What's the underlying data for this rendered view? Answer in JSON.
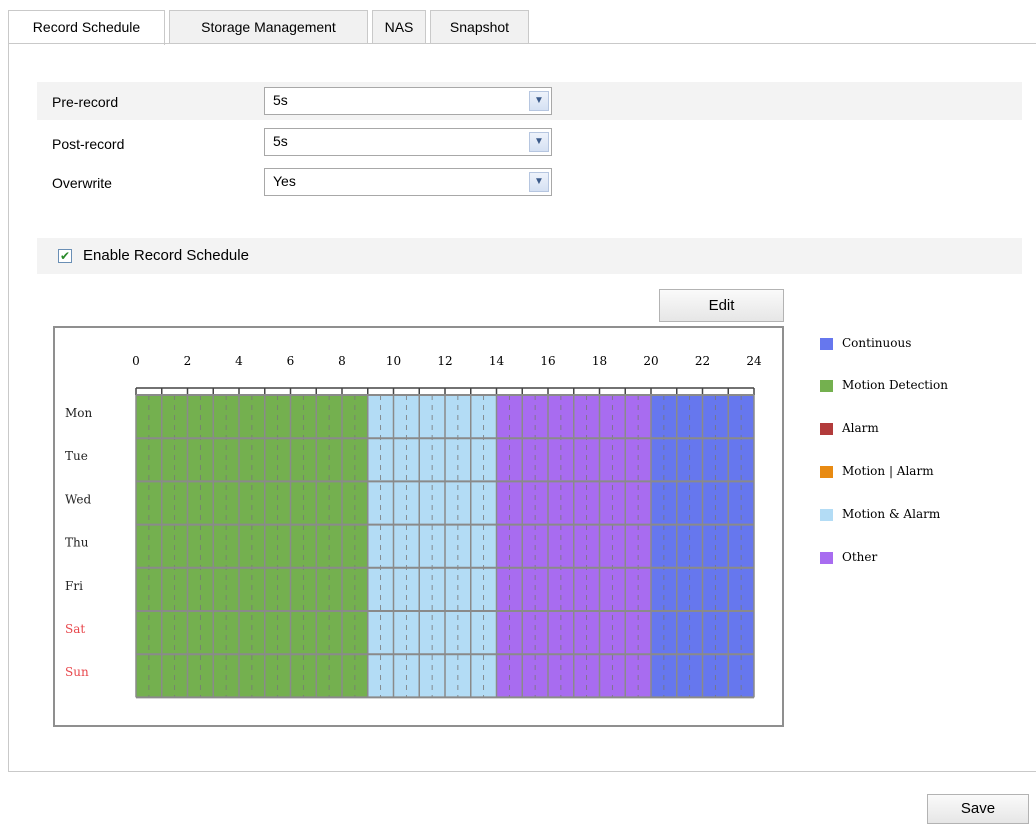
{
  "tabs": [
    {
      "label": "Record Schedule",
      "active": true
    },
    {
      "label": "Storage Management",
      "active": false
    },
    {
      "label": "NAS",
      "active": false
    },
    {
      "label": "Snapshot",
      "active": false
    }
  ],
  "settings": {
    "pre_record": {
      "label": "Pre-record",
      "value": "5s"
    },
    "post_record": {
      "label": "Post-record",
      "value": "5s"
    },
    "overwrite": {
      "label": "Overwrite",
      "value": "Yes"
    }
  },
  "enable_schedule": {
    "label": "Enable Record Schedule",
    "checked": true
  },
  "edit_label": "Edit",
  "save_label": "Save",
  "schedule": {
    "hour_ticks": [
      "0",
      "2",
      "4",
      "6",
      "8",
      "10",
      "12",
      "14",
      "16",
      "18",
      "20",
      "22",
      "24"
    ],
    "days": [
      {
        "label": "Mon",
        "weekend": false
      },
      {
        "label": "Tue",
        "weekend": false
      },
      {
        "label": "Wed",
        "weekend": false
      },
      {
        "label": "Thu",
        "weekend": false
      },
      {
        "label": "Fri",
        "weekend": false
      },
      {
        "label": "Sat",
        "weekend": true
      },
      {
        "label": "Sun",
        "weekend": true
      }
    ],
    "segments": [
      {
        "start": 0,
        "end": 9,
        "type": "Motion Detection"
      },
      {
        "start": 9,
        "end": 14,
        "type": "Motion & Alarm"
      },
      {
        "start": 14,
        "end": 20,
        "type": "Other"
      },
      {
        "start": 20,
        "end": 24,
        "type": "Continuous"
      }
    ],
    "weekend_color": "#e8474c"
  },
  "legend": [
    {
      "label": "Continuous",
      "color": "#6677ee"
    },
    {
      "label": "Motion Detection",
      "color": "#74b04f"
    },
    {
      "label": "Alarm",
      "color": "#b23b3b"
    },
    {
      "label": "Motion | Alarm",
      "color": "#e88a12"
    },
    {
      "label": "Motion & Alarm",
      "color": "#b3dcf5"
    },
    {
      "label": "Other",
      "color": "#a86cf0"
    }
  ]
}
